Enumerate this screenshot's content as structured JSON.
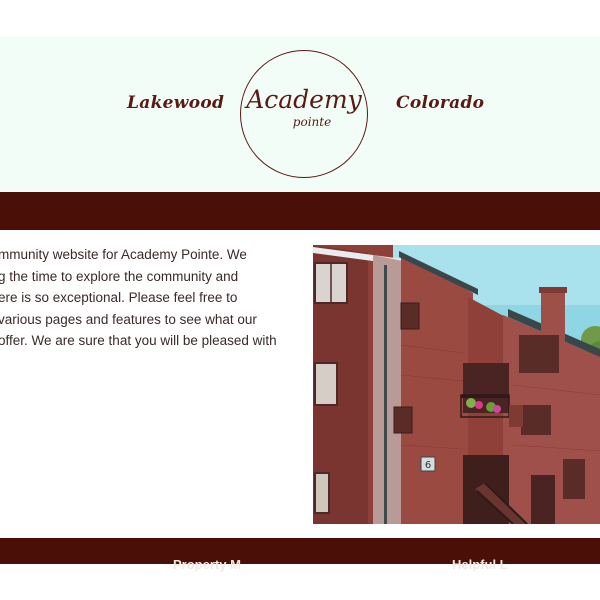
{
  "header": {
    "left_word": "Lakewood",
    "right_word": "Colorado",
    "logo_title": "Academy",
    "logo_subtitle": "pointe"
  },
  "intro": {
    "lines": [
      "mmunity website for Academy Pointe. We",
      "g the time to explore the community and",
      "ere is so exceptional. Please feel free to",
      " various pages and features to see what our",
      "offer. We are sure that you will be pleased with"
    ]
  },
  "photo": {
    "building_number": "6"
  },
  "footer": {
    "left_heading": "Property M",
    "right_heading": "Helpful L"
  },
  "colors": {
    "brand_maroon": "#4a0f06",
    "header_bg": "#f3fdf8",
    "logo_ink": "#5a1a12"
  }
}
